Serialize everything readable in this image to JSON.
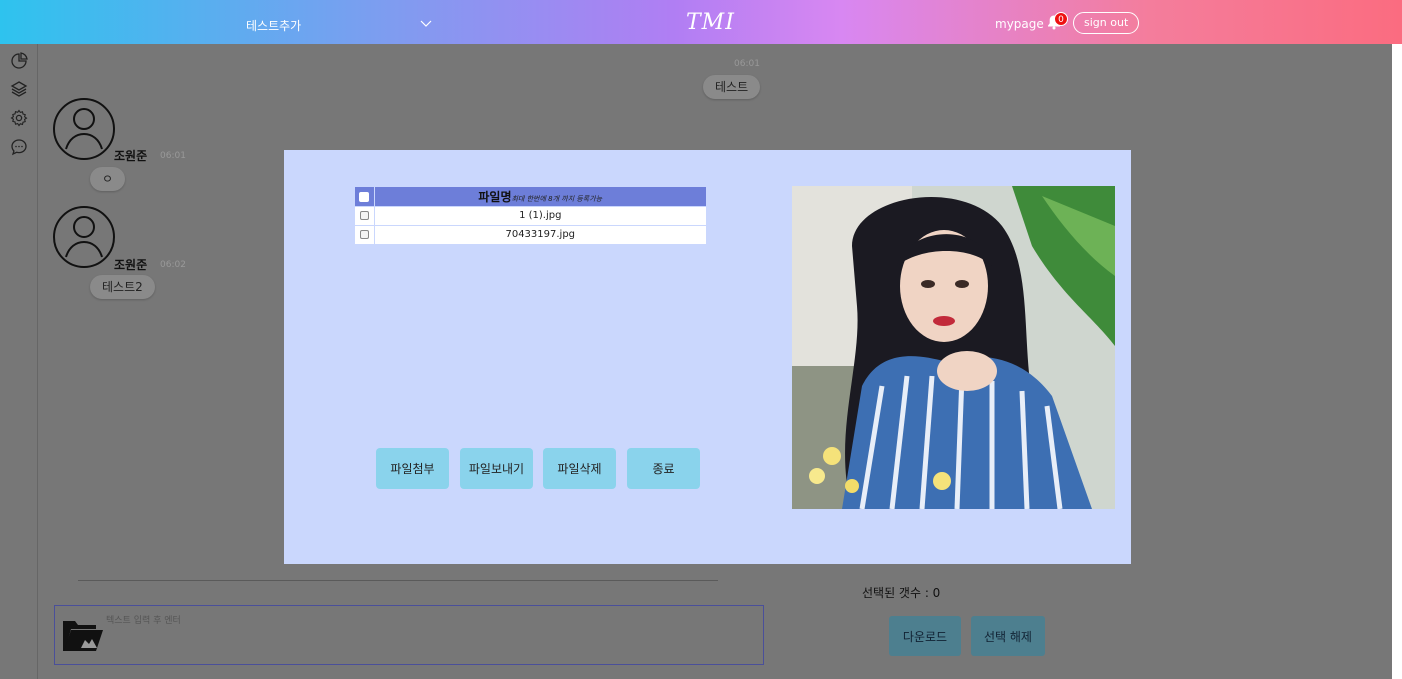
{
  "header": {
    "room_title": "테스트추가",
    "logo": "TMI",
    "mypage_label": "mypage",
    "notification_count": "0",
    "signout_label": "sign out"
  },
  "sidebar": {
    "icons": [
      "pie-chart-icon",
      "layers-icon",
      "gear-icon",
      "chat-bubble-icon"
    ]
  },
  "chat": {
    "messages": [
      {
        "time": "06:01",
        "text": "테스트",
        "mine": true
      },
      {
        "sender": "조원준",
        "time": "06:01",
        "text": "ㅇ"
      },
      {
        "sender": "조원준",
        "time": "06:02",
        "text": "테스트2"
      }
    ]
  },
  "composer": {
    "placeholder": "텍스트 입력 후 엔터"
  },
  "selection": {
    "count_label": "선택된 갯수 : 0",
    "download_label": "다운로드",
    "deselect_label": "선택 해제"
  },
  "modal": {
    "table_header": "파일명",
    "table_hint": "최대 한번에 8개 까지 등록가능",
    "files": [
      "1 (1).jpg",
      "70433197.jpg"
    ],
    "buttons": {
      "attach": "파일첨부",
      "send": "파일보내기",
      "delete": "파일삭제",
      "close": "종료"
    }
  }
}
